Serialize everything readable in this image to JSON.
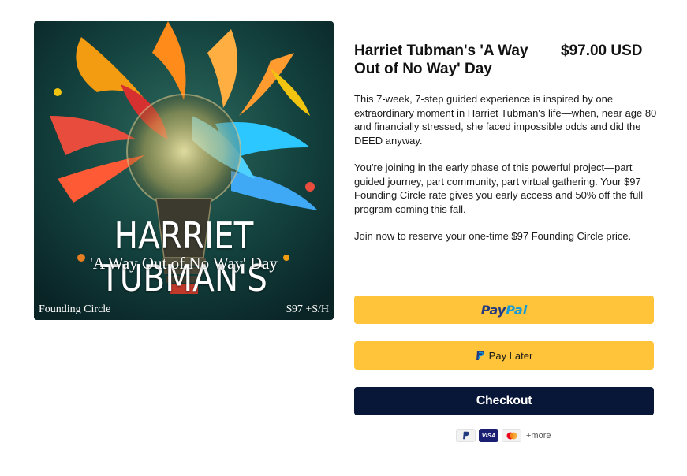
{
  "image": {
    "title": "HARRIET TUBMAN'S",
    "subtitle": "'A Way Out of No Way' Day",
    "footer_left": "Founding Circle",
    "footer_right": "$97 +S/H"
  },
  "product": {
    "title": "Harriet Tubman's 'A Way Out of No Way' Day",
    "price": "$97.00 USD",
    "description": [
      "This 7-week, 7-step guided experience is inspired by one extraordinary moment in Harriet Tubman's life—when, near age 80 and financially stressed, she faced impossible odds and did the DEED anyway.",
      "You're joining in the early phase of this powerful project—part guided journey, part community, part virtual gathering. Your $97 Founding Circle rate gives you early access and 50% off the full program coming this fall.",
      "Join now to reserve your one-time $97 Founding Circle price."
    ]
  },
  "buttons": {
    "paypal_part1": "Pay",
    "paypal_part2": "Pal",
    "pay_later": "Pay Later",
    "checkout": "Checkout"
  },
  "payment_icons": {
    "paypal_icon": "paypal-icon",
    "visa": "VISA",
    "mastercard_icon": "mastercard-icon",
    "more": "+more"
  },
  "colors": {
    "paypal_yellow": "#ffc439",
    "checkout_navy": "#081637",
    "paypal_dark_blue": "#253b80",
    "paypal_light_blue": "#179bd7"
  }
}
